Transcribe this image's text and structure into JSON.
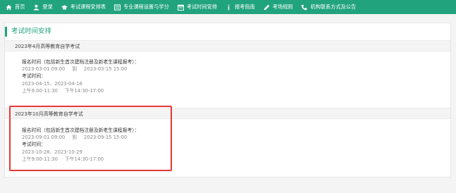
{
  "nav": {
    "items": [
      {
        "icon": "home-icon",
        "label": "首页"
      },
      {
        "icon": "user-icon",
        "label": "登录"
      },
      {
        "icon": "graduation-cap-icon",
        "label": "考试课程安排表"
      },
      {
        "icon": "list-icon",
        "label": "专业课程设置与学分"
      },
      {
        "icon": "calendar-icon",
        "label": "考试时间安排"
      },
      {
        "icon": "info-icon",
        "label": "报考指南"
      },
      {
        "icon": "pencil-icon",
        "label": "考场规则"
      },
      {
        "icon": "phone-icon",
        "label": "机构联系方式及公告"
      }
    ]
  },
  "panel": {
    "title": "考试时间安排",
    "sections": [
      {
        "title": "2023年4月高等教育自学考试",
        "registration_label": "报名时间（包括新生首次建档注册及新老生课程报考）：",
        "registration_start": "2023-03-01 09:00",
        "registration_to": "到",
        "registration_end": "2023-03-15 15:00",
        "exam_label": "考试时间：",
        "exam_dates": "2023-04-15、2023-04-16",
        "morning": "上午9:00-11:30",
        "afternoon": "下午14:30-17:00"
      },
      {
        "title": "2023年10月高等教育自学考试",
        "registration_label": "报名时间（包括新生首次建档注册及新老生课程报考）：",
        "registration_start": "2023-09-01 09:00",
        "registration_to": "到",
        "registration_end": "2023-09-15 15:00",
        "exam_label": "考试时间：",
        "exam_dates": "2023-10-28、2023-10-29",
        "morning": "上午9:00-11:30",
        "afternoon": "下午14:30-17:00"
      }
    ]
  },
  "colors": {
    "nav_bg": "#21a37e",
    "accent": "#21a37e",
    "highlight": "#e53935"
  }
}
